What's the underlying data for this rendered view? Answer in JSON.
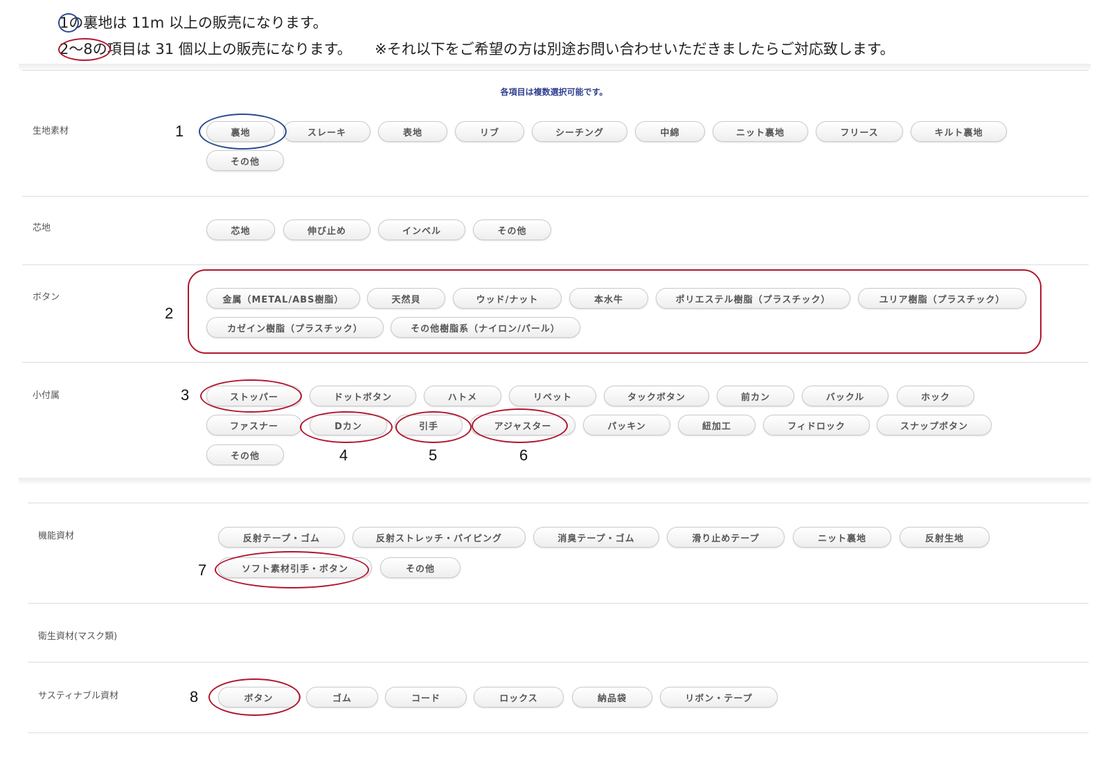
{
  "notes": {
    "line1_num": "1",
    "line1_text": "の裏地は 11m 以上の販売になります。",
    "line2_num": "2～8",
    "line2_text": "の項目は 31 個以上の販売になります。",
    "line2_extra": "※それ以下をご希望の方は別途お問い合わせいただきましたらご対応致します。"
  },
  "hint": "各項目は複数選択可能です。",
  "rows": [
    {
      "label": "生地素材",
      "items": [
        "裏地",
        "スレーキ",
        "表地",
        "リブ",
        "シーチング",
        "中綿",
        "ニット裏地",
        "フリース",
        "キルト裏地",
        "その他"
      ]
    },
    {
      "label": "芯地",
      "items": [
        "芯地",
        "伸び止め",
        "インベル",
        "その他"
      ]
    },
    {
      "label": "ボタン",
      "items": [
        "金属（METAL/ABS樹脂）",
        "天然貝",
        "ウッド/ナット",
        "本水牛",
        "ポリエステル樹脂（プラスチック）",
        "ユリア樹脂（プラスチック）",
        "カゼイン樹脂（プラスチック）",
        "その他樹脂系（ナイロン/パール）"
      ]
    },
    {
      "label": "小付属",
      "items": [
        "ストッパー",
        "ドットボタン",
        "ハトメ",
        "リベット",
        "タックボタン",
        "前カン",
        "バックル",
        "ホック",
        "ファスナー",
        "Dカン",
        "引手",
        "アジャスター",
        "パッキン",
        "紐加工",
        "フィドロック",
        "スナップボタン",
        "その他"
      ]
    },
    {
      "label": "機能資材",
      "items": [
        "反射テープ・ゴム",
        "反射ストレッチ・パイピング",
        "消臭テープ・ゴム",
        "滑り止めテープ",
        "ニット裏地",
        "反射生地",
        "ソフト素材引手・ボタン",
        "その他"
      ]
    },
    {
      "label": "衛生資材(マスク類)",
      "items": []
    },
    {
      "label": "サスティナブル資材",
      "items": [
        "ボタン",
        "ゴム",
        "コード",
        "ロックス",
        "納品袋",
        "リボン・テープ"
      ]
    }
  ],
  "annotations": [
    "1",
    "2",
    "3",
    "4",
    "5",
    "6",
    "7",
    "8"
  ],
  "colors": {
    "highlight_red": "#b0162d",
    "highlight_blue": "#2a4a8f",
    "hint_text": "#2f3f8f"
  }
}
